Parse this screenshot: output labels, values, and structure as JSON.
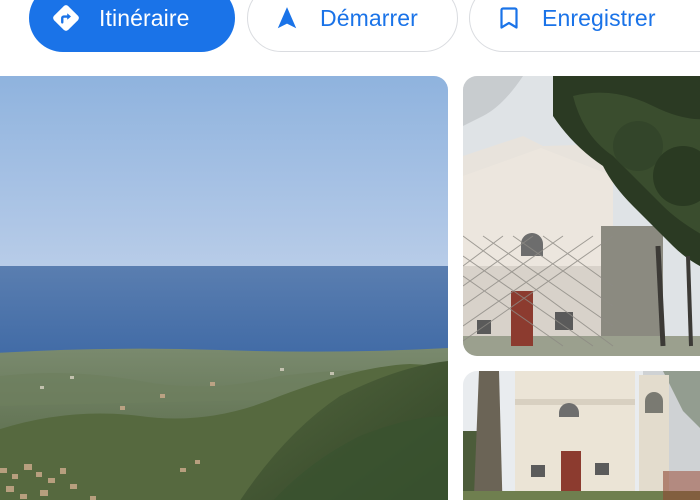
{
  "actions": {
    "directions_label": "Itinéraire",
    "start_label": "Démarrer",
    "save_label": "Enregistrer"
  },
  "icons": {
    "directions": "directions-icon",
    "start": "navigation-arrow-icon",
    "save": "bookmark-icon"
  },
  "colors": {
    "accent": "#1a73e8",
    "chip_border": "#dadce0",
    "background": "#ffffff"
  },
  "photos": [
    {
      "name": "panorama-sea-coast-photo"
    },
    {
      "name": "chapel-behind-fence-photo"
    },
    {
      "name": "chapel-with-bell-tower-photo"
    }
  ]
}
